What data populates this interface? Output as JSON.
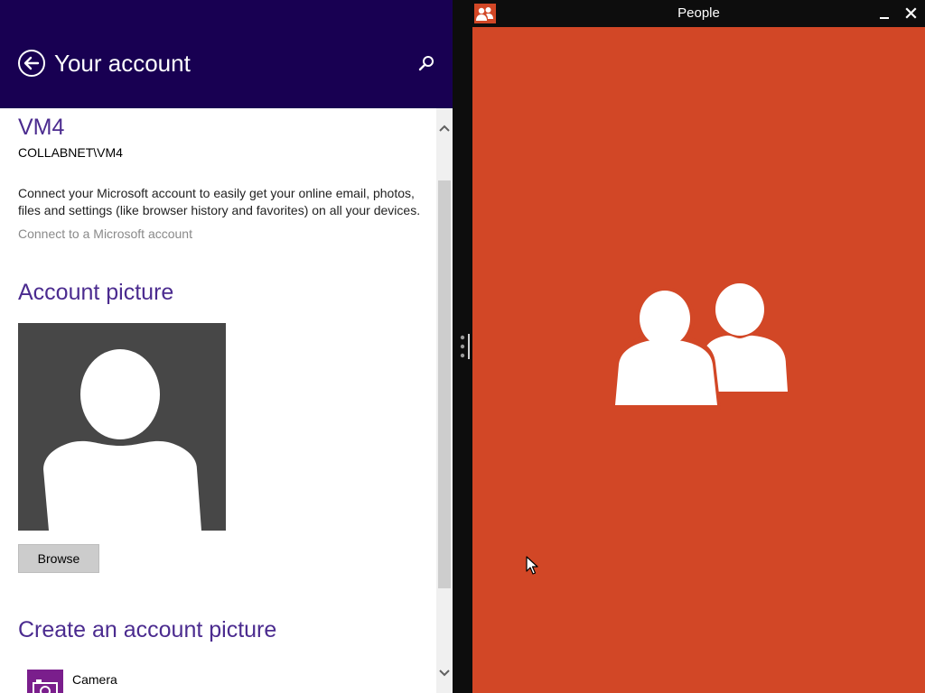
{
  "settings": {
    "header": {
      "title": "Your account",
      "back_icon": "back-arrow-icon",
      "search_icon": "search-icon",
      "background_color": "#180052"
    },
    "account": {
      "name": "VM4",
      "domain": "COLLABNET\\VM4"
    },
    "description": {
      "line1": "Connect your Microsoft account to easily get your online email, photos,",
      "line2": "files and settings (like browser history and favorites) on all your devices."
    },
    "connect_link": "Connect to a Microsoft account",
    "account_picture": {
      "heading": "Account picture",
      "browse_label": "Browse"
    },
    "create_picture": {
      "heading": "Create an account picture",
      "camera_label": "Camera"
    },
    "accent_color": "#4b2b8f"
  },
  "people_app": {
    "title": "People",
    "app_icon": "people-icon",
    "background_color": "#d24726"
  }
}
